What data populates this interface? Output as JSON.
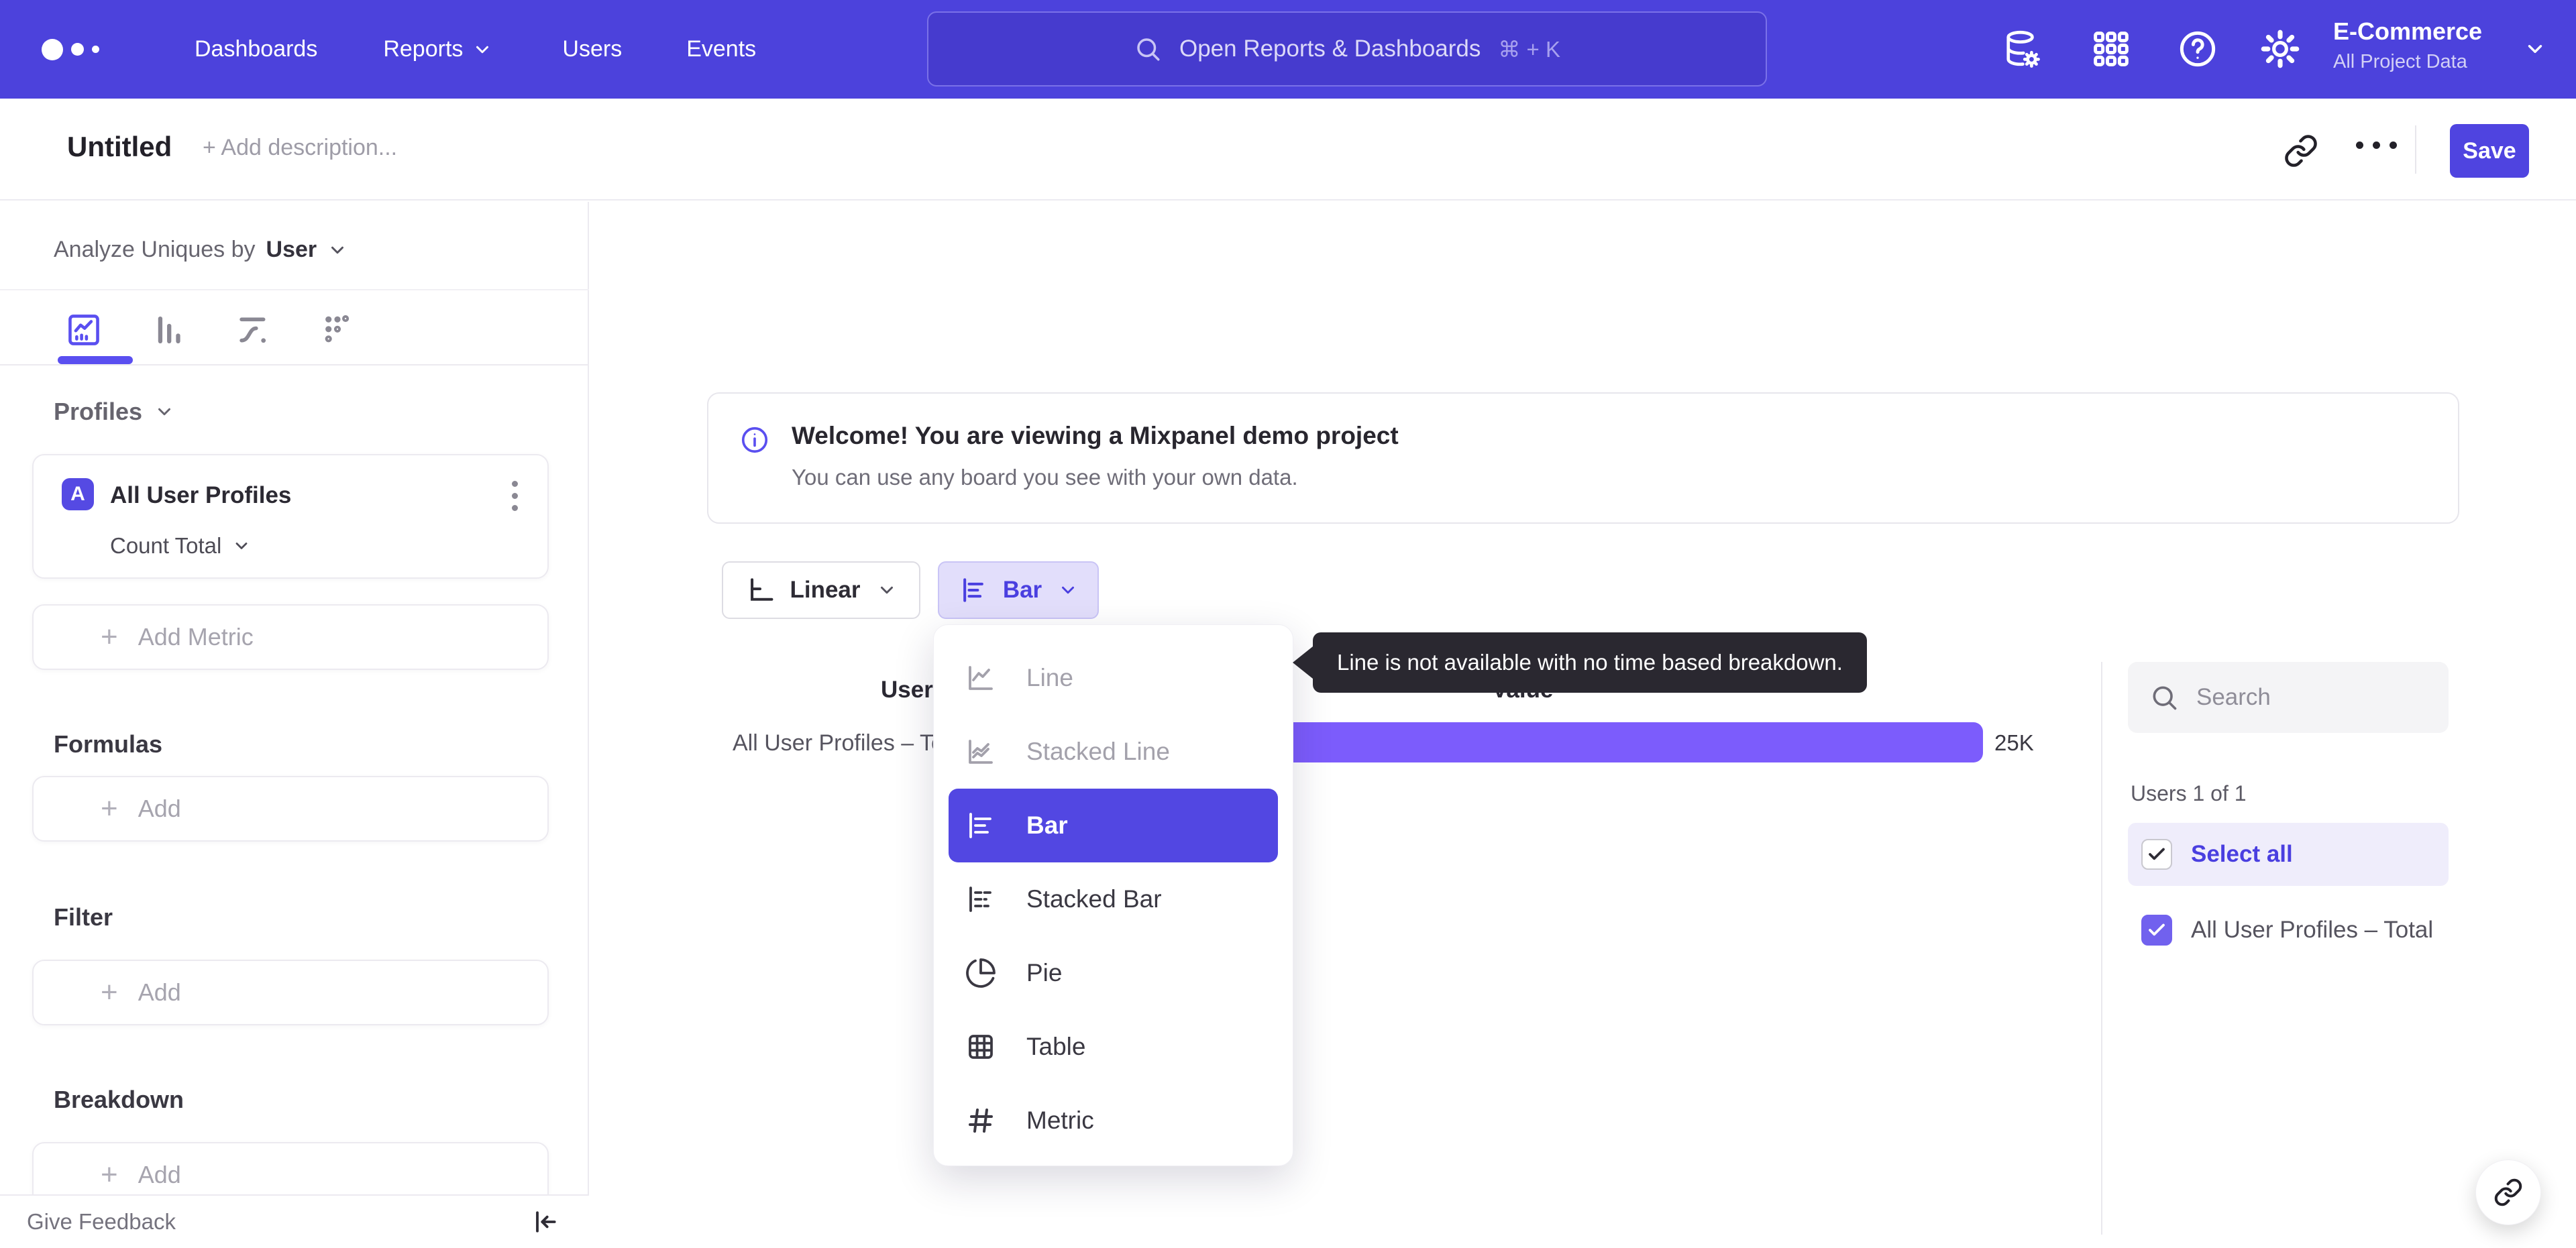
{
  "topnav": {
    "nav": [
      "Dashboards",
      "Reports",
      "Users",
      "Events"
    ],
    "search_placeholder": "Open Reports & Dashboards",
    "search_shortcut": "⌘ + K",
    "project_name": "E-Commerce",
    "project_scope": "All Project Data"
  },
  "header": {
    "title": "Untitled",
    "description_placeholder": "+ Add description...",
    "save_label": "Save"
  },
  "sidebar": {
    "analyze_prefix": "Analyze Uniques by",
    "analyze_value": "User",
    "profiles_header": "Profiles",
    "metric_badge": "A",
    "metric_name": "All User Profiles",
    "metric_aggregation": "Count Total",
    "add_metric_label": "Add Metric",
    "add_label": "Add",
    "plus_glyph": "+",
    "formulas_header": "Formulas",
    "filter_header": "Filter",
    "breakdown_header": "Breakdown",
    "give_feedback": "Give Feedback"
  },
  "banner": {
    "title": "Welcome! You are viewing a Mixpanel demo project",
    "subtitle": "You can use any board you see with your own data."
  },
  "controls": {
    "scale_label": "Linear",
    "chart_type_label": "Bar"
  },
  "dropdown": {
    "items": [
      {
        "label": "Line",
        "state": "disabled"
      },
      {
        "label": "Stacked Line",
        "state": "disabled"
      },
      {
        "label": "Bar",
        "state": "selected"
      },
      {
        "label": "Stacked Bar",
        "state": "enabled"
      },
      {
        "label": "Pie",
        "state": "enabled"
      },
      {
        "label": "Table",
        "state": "enabled"
      },
      {
        "label": "Metric",
        "state": "enabled"
      }
    ]
  },
  "tooltip": {
    "text": "Line is not available with no time based breakdown."
  },
  "chart": {
    "col_users": "Users",
    "col_value": "Value",
    "row_label": "All User Profiles – Total",
    "value_label": "25K"
  },
  "chart_data": {
    "type": "bar",
    "orientation": "horizontal",
    "categories": [
      "All User Profiles – Total"
    ],
    "values": [
      25000
    ],
    "value_labels": [
      "25K"
    ],
    "series_color": "#7c5cfc",
    "columns": [
      "Users",
      "Value"
    ]
  },
  "right_panel": {
    "search_placeholder": "Search",
    "count": "Users 1 of 1",
    "select_all_label": "Select all",
    "item_label": "All User Profiles – Total"
  },
  "colors": {
    "accent": "#4f44e0",
    "nav_bg": "#4c42dc",
    "bar": "#7c5cfc",
    "selected_item_bg": "#5247e2",
    "tooltip_bg": "#2a2830"
  }
}
